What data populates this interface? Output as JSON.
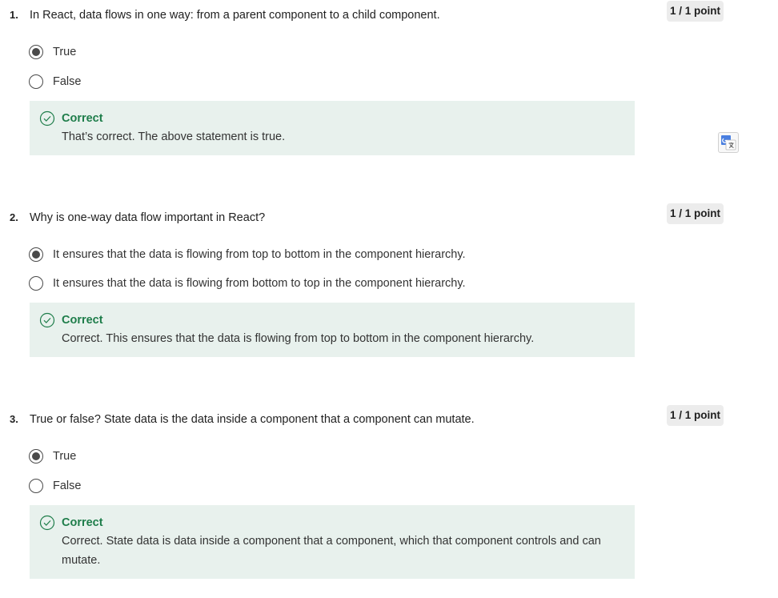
{
  "questions": [
    {
      "number": "1.",
      "text": "In React, data flows in one way: from a parent component to a child component.",
      "score": "1 / 1 point",
      "options": [
        {
          "label": "True",
          "selected": true
        },
        {
          "label": "False",
          "selected": false
        }
      ],
      "feedback": {
        "title": "Correct",
        "text": "That’s correct. The above statement is true."
      }
    },
    {
      "number": "2.",
      "text": "Why is one-way data flow important in React?",
      "score": "1 / 1 point",
      "options": [
        {
          "label": "It ensures that the data is flowing from top to bottom in the component hierarchy.",
          "selected": true
        },
        {
          "label": "It ensures that the data is flowing from bottom to top in the component hierarchy.",
          "selected": false
        }
      ],
      "feedback": {
        "title": "Correct",
        "text": "Correct. This ensures that the data is flowing from top to bottom in the component hierarchy."
      }
    },
    {
      "number": "3.",
      "text": "True or false? State data is the data inside a component that a component can mutate.",
      "score": "1 / 1 point",
      "options": [
        {
          "label": "True",
          "selected": true
        },
        {
          "label": "False",
          "selected": false
        }
      ],
      "feedback": {
        "title": "Correct",
        "text": "Correct. State data is data inside a component that a component, which that component controls and can mutate."
      }
    }
  ],
  "icons": {
    "selected_radio": "radio-selected-icon",
    "unselected_radio": "radio-unselected-icon",
    "feedback": "check-circle-icon",
    "translate": "google-translate-icon"
  },
  "colors": {
    "feedback_bg": "#e8f1ed",
    "correct_text": "#1e7d4a",
    "badge_bg": "#ececec"
  }
}
